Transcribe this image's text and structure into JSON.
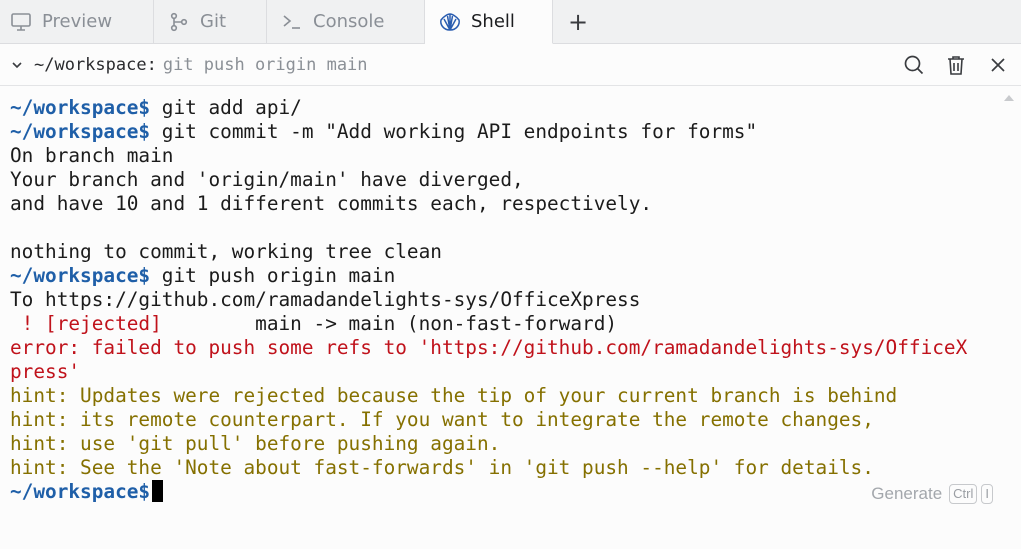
{
  "tabs": [
    {
      "label": "Preview",
      "icon": "monitor-icon",
      "active": false
    },
    {
      "label": "Git",
      "icon": "git-branch-icon",
      "active": false
    },
    {
      "label": "Console",
      "icon": "terminal-prompt-icon",
      "active": false
    },
    {
      "label": "Shell",
      "icon": "shell-icon",
      "active": true
    }
  ],
  "new_tab_label": "+",
  "toolbar": {
    "path": "~/workspace:",
    "command_preview": "git push origin main"
  },
  "terminal": {
    "prompt": "~/workspace$",
    "lines": [
      {
        "type": "cmd",
        "text": " git add api/"
      },
      {
        "type": "cmd",
        "text": " git commit -m \"Add working API endpoints for forms\""
      },
      {
        "type": "out",
        "text": "On branch main"
      },
      {
        "type": "out",
        "text": "Your branch and 'origin/main' have diverged,"
      },
      {
        "type": "out",
        "text": "and have 10 and 1 different commits each, respectively."
      },
      {
        "type": "out",
        "text": ""
      },
      {
        "type": "out",
        "text": "nothing to commit, working tree clean"
      },
      {
        "type": "cmd",
        "text": " git push origin main"
      },
      {
        "type": "out",
        "text": "To https://github.com/ramadandelights-sys/OfficeXpress"
      },
      {
        "type": "reject",
        "text": " ! [rejected]",
        "rest": "        main -> main (non-fast-forward)"
      },
      {
        "type": "error",
        "text": "error: failed to push some refs to 'https://github.com/ramadandelights-sys/OfficeX"
      },
      {
        "type": "error",
        "text": "press'"
      },
      {
        "type": "hint",
        "text": "hint: Updates were rejected because the tip of your current branch is behind"
      },
      {
        "type": "hint",
        "text": "hint: its remote counterpart. If you want to integrate the remote changes,"
      },
      {
        "type": "hint",
        "text": "hint: use 'git pull' before pushing again."
      },
      {
        "type": "hint",
        "text": "hint: See the 'Note about fast-forwards' in 'git push --help' for details."
      }
    ]
  },
  "generate": {
    "label": "Generate",
    "key1": "Ctrl",
    "key2": "I"
  }
}
